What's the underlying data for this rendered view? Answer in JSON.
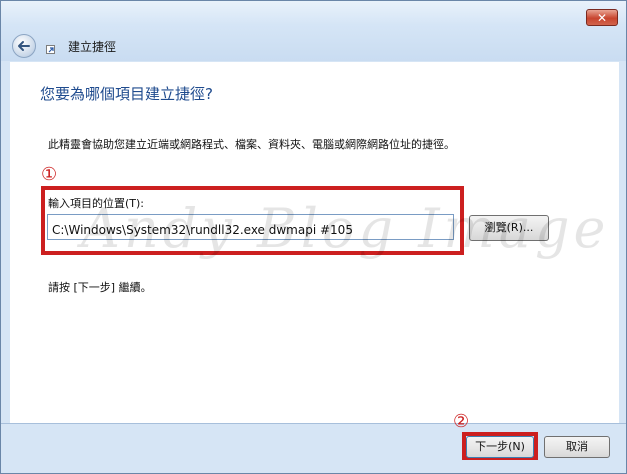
{
  "window": {
    "title": "建立捷徑",
    "close_symbol": "✕",
    "back_icon": "back-arrow-icon",
    "title_icon": "shortcut-icon"
  },
  "main": {
    "heading": "您要為哪個項目建立捷徑?",
    "description": "此精靈會協助您建立近端或網路程式、檔案、資料夾、電腦或網際網路位址的捷徑。",
    "location_label": "輸入項目的位置(T):",
    "location_value": "C:\\Windows\\System32\\rundll32.exe dwmapi #105",
    "browse_label": "瀏覽(R)...",
    "next_hint": "請按 [下一步] 繼續。"
  },
  "annotations": {
    "marker1": "①",
    "marker2": "②",
    "watermark": "Andy Blog Image",
    "highlight_color": "#cc1f1f"
  },
  "footer": {
    "next_label": "下一步(N)",
    "cancel_label": "取消"
  }
}
